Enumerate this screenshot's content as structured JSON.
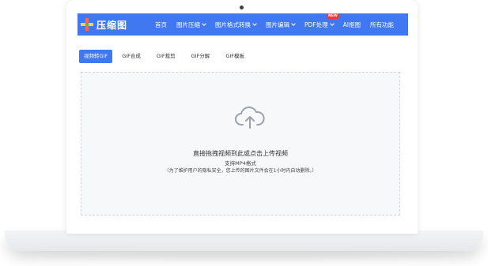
{
  "brand": {
    "name": "压缩图"
  },
  "nav": {
    "items": [
      {
        "label": "首页",
        "has_dropdown": false
      },
      {
        "label": "图片压缩",
        "has_dropdown": true
      },
      {
        "label": "图片格式转换",
        "has_dropdown": true
      },
      {
        "label": "图片编辑",
        "has_dropdown": true
      },
      {
        "label": "PDF处理",
        "has_dropdown": true,
        "badge": "NEW"
      },
      {
        "label": "AI抠图",
        "has_dropdown": false
      },
      {
        "label": "所有功能",
        "has_dropdown": false
      }
    ]
  },
  "tabs": [
    {
      "label": "视频转GIF",
      "active": true
    },
    {
      "label": "GIF合成",
      "active": false
    },
    {
      "label": "GIF裁剪",
      "active": false
    },
    {
      "label": "GIF分解",
      "active": false
    },
    {
      "label": "GIF模板",
      "active": false
    }
  ],
  "dropzone": {
    "icon": "cloud-upload-icon",
    "main_text": "直接拖拽视频到此或点击上传视频",
    "sub_text": "支持MP4格式",
    "note": "（为了维护用户的隐私安全，您上传的图片文件会在1小时内自动删除。）"
  },
  "colors": {
    "accent": "#3f78f0",
    "badge": "#f03a3a",
    "icon_gray": "#9aa3ad"
  }
}
